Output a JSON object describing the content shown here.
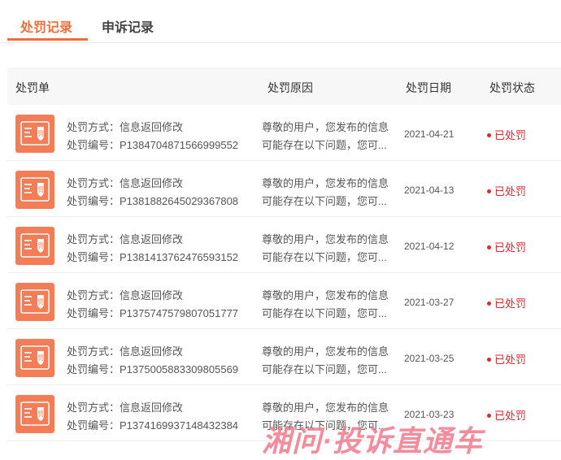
{
  "tabs": [
    {
      "label": "处罚记录",
      "active": true
    },
    {
      "label": "申诉记录",
      "active": false
    }
  ],
  "columns": {
    "order": "处罚单",
    "reason": "处罚原因",
    "date": "处罚日期",
    "status": "处罚状态"
  },
  "rows": [
    {
      "method": "处罚方式：信息返回修改",
      "number": "处罚编号：P1384704871566999552",
      "reason_line1": "尊敬的用户，您发布的信息",
      "reason_line2": "可能存在以下问题，您可...",
      "date": "2021-04-21",
      "status": "已处罚"
    },
    {
      "method": "处罚方式：信息返回修改",
      "number": "处罚编号：P1381882645029367808",
      "reason_line1": "尊敬的用户，您发布的信息",
      "reason_line2": "可能存在以下问题，您可...",
      "date": "2021-04-13",
      "status": "已处罚"
    },
    {
      "method": "处罚方式：信息返回修改",
      "number": "处罚编号：P1381413762476593152",
      "reason_line1": "尊敬的用户，您发布的信息",
      "reason_line2": "可能存在以下问题，您可...",
      "date": "2021-04-12",
      "status": "已处罚"
    },
    {
      "method": "处罚方式：信息返回修改",
      "number": "处罚编号：P1375747579807051777",
      "reason_line1": "尊敬的用户，您发布的信息",
      "reason_line2": "可能存在以下问题，您可...",
      "date": "2021-03-27",
      "status": "已处罚"
    },
    {
      "method": "处罚方式：信息返回修改",
      "number": "处罚编号：P1375005883309805569",
      "reason_line1": "尊敬的用户，您发布的信息",
      "reason_line2": "可能存在以下问题，您可...",
      "date": "2021-03-25",
      "status": "已处罚"
    },
    {
      "method": "处罚方式：信息返回修改",
      "number": "处罚编号：P1374169937148432384",
      "reason_line1": "尊敬的用户，您发布的信息",
      "reason_line2": "可能存在以下问题，您可...",
      "date": "2021-03-23",
      "status": "已处罚"
    }
  ],
  "row_icon": "penalty-ticket-icon",
  "watermark": "湘问·投诉直通车",
  "colors": {
    "accent": "#f06d3c",
    "icon_bg": "#f47c57",
    "status": "#e2262b"
  }
}
